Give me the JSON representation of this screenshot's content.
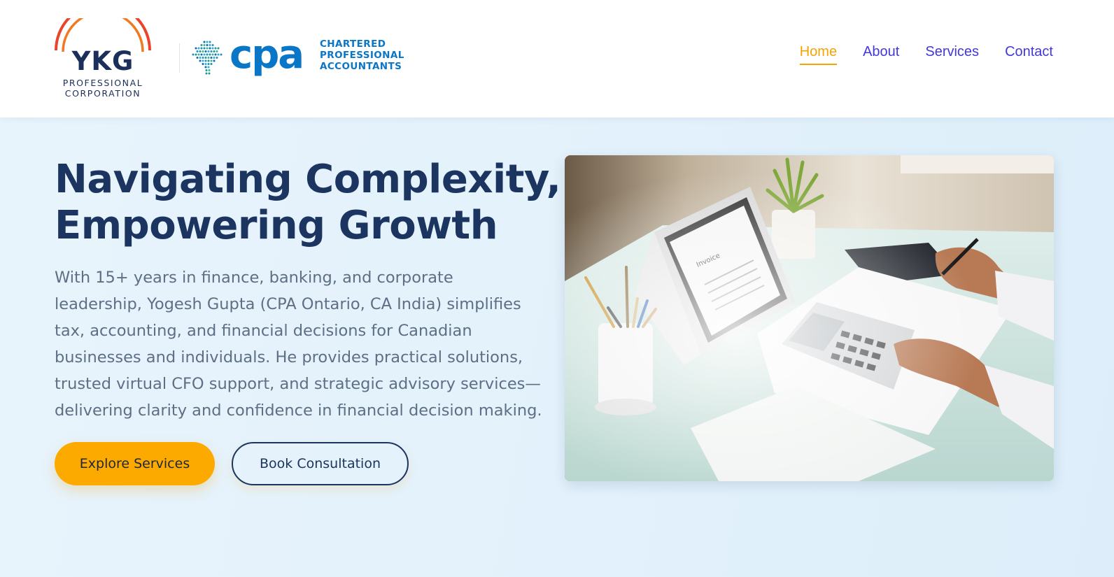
{
  "brand": {
    "ykg_letters": "YKG",
    "ykg_line1": "PROFESSIONAL",
    "ykg_line2": "CORPORATION",
    "cpa_word": "CPA",
    "cpa_line1": "CHARTERED",
    "cpa_line2": "PROFESSIONAL",
    "cpa_line3": "ACCOUNTANTS"
  },
  "nav": {
    "items": [
      {
        "label": "Home",
        "active": true
      },
      {
        "label": "About"
      },
      {
        "label": "Services"
      },
      {
        "label": "Contact"
      }
    ]
  },
  "hero": {
    "title_line1": "Navigating Complexity,",
    "title_line2": "Empowering Growth",
    "body": "With 15+ years in finance, banking, and corporate leadership, Yogesh Gupta (CPA Ontario, CA India) simplifies tax, accounting, and financial decisions for Canadian businesses and individuals. He provides practical solutions, trusted virtual CFO support, and strategic advisory services—delivering clarity and confidence in financial decision making.",
    "primary_button": "Explore Services",
    "secondary_button": "Book Consultation",
    "image_document_title": "Invoice"
  },
  "colors": {
    "navy": "#1c3560",
    "accent": "#fdaa00",
    "nav_link": "#4338d8",
    "cpa_blue": "#0a76c8",
    "hero_bg": "#e5f3fc"
  }
}
